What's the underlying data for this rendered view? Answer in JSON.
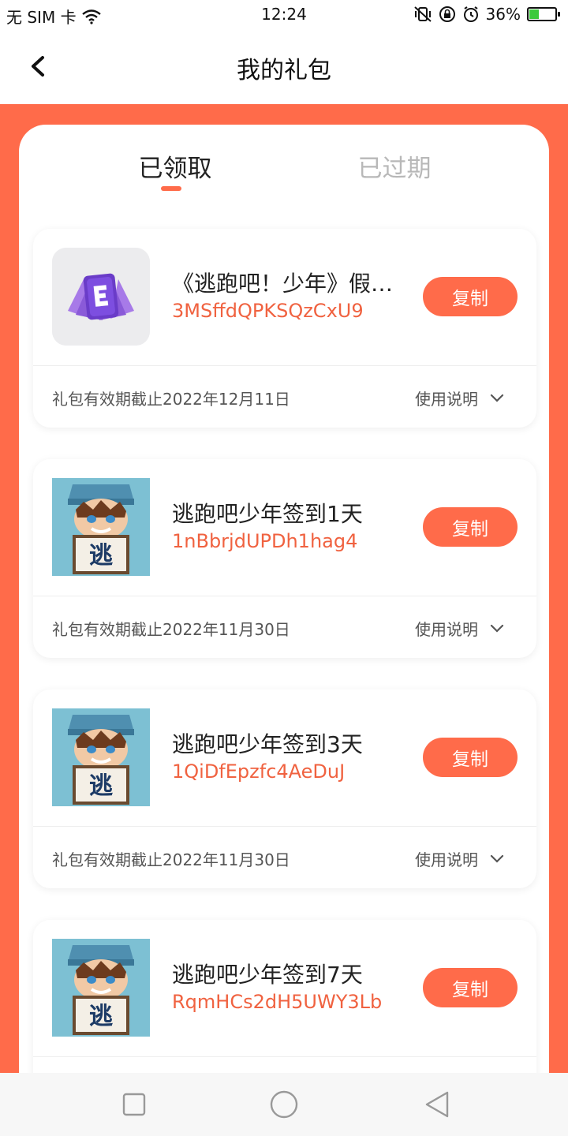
{
  "status_bar": {
    "carrier": "无 SIM 卡",
    "time": "12:24",
    "battery_percent": "36%",
    "battery_level": 0.36
  },
  "header": {
    "title": "我的礼包"
  },
  "tabs": [
    {
      "label": "已领取",
      "active": true
    },
    {
      "label": "已过期",
      "active": false
    }
  ],
  "gifts": [
    {
      "name": "《逃跑吧！少年》假…",
      "code": "3MSffdQPKSQzCxU9",
      "copy_label": "复制",
      "expiry": "礼包有效期截止2022年12月11日",
      "instructions_label": "使用说明",
      "icon": "purple-card-icon"
    },
    {
      "name": "逃跑吧少年签到1天",
      "code": "1nBbrjdUPDh1hag4",
      "copy_label": "复制",
      "expiry": "礼包有效期截止2022年11月30日",
      "instructions_label": "使用说明",
      "icon": "game-avatar-icon"
    },
    {
      "name": "逃跑吧少年签到3天",
      "code": "1QiDfEpzfc4AeDuJ",
      "copy_label": "复制",
      "expiry": "礼包有效期截止2022年11月30日",
      "instructions_label": "使用说明",
      "icon": "game-avatar-icon"
    },
    {
      "name": "逃跑吧少年签到7天",
      "code": "RqmHCs2dH5UWY3Lb",
      "copy_label": "复制",
      "icon": "game-avatar-icon"
    }
  ],
  "colors": {
    "accent": "#ff6b4a",
    "code_text": "#f06240"
  }
}
